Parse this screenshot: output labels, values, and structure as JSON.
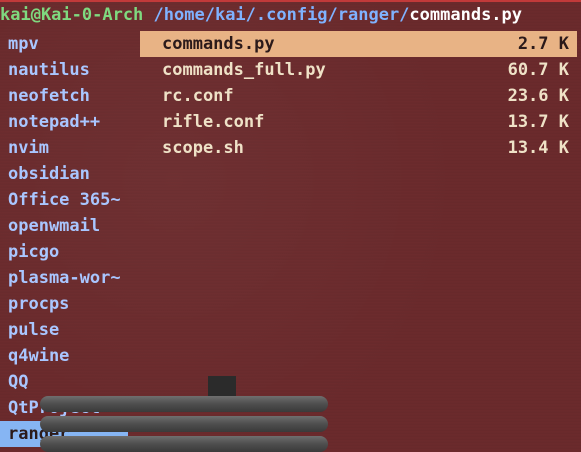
{
  "title": {
    "user_host": "kai@Kai-0-Arch",
    "path": "/home/kai/.config/ranger/",
    "file": "commands.py"
  },
  "left_pane": {
    "items": [
      "mpv",
      "nautilus",
      "neofetch",
      "notepad++",
      "nvim",
      "obsidian",
      "Office 365~",
      "openwmail",
      "picgo",
      "plasma-wor~",
      "procps",
      "pulse",
      "q4wine",
      "QQ",
      "QtProject",
      "ranger"
    ],
    "selected": "ranger"
  },
  "right_pane": {
    "files": [
      {
        "name": "commands.py",
        "size": "2.7 K"
      },
      {
        "name": "commands_full.py",
        "size": "60.7 K"
      },
      {
        "name": "rc.conf",
        "size": "23.6 K"
      },
      {
        "name": "rifle.conf",
        "size": "13.7 K"
      },
      {
        "name": "scope.sh",
        "size": "13.4 K"
      }
    ],
    "selected": "commands.py"
  },
  "colors": {
    "background": "#6b2a2c",
    "user_host": "#7fd97f",
    "path": "#7fb2ff",
    "left_selection": "#86b5f3",
    "right_selection": "#e8b385",
    "directory_text": "#a9c6ff",
    "file_text": "#efe2c7"
  }
}
